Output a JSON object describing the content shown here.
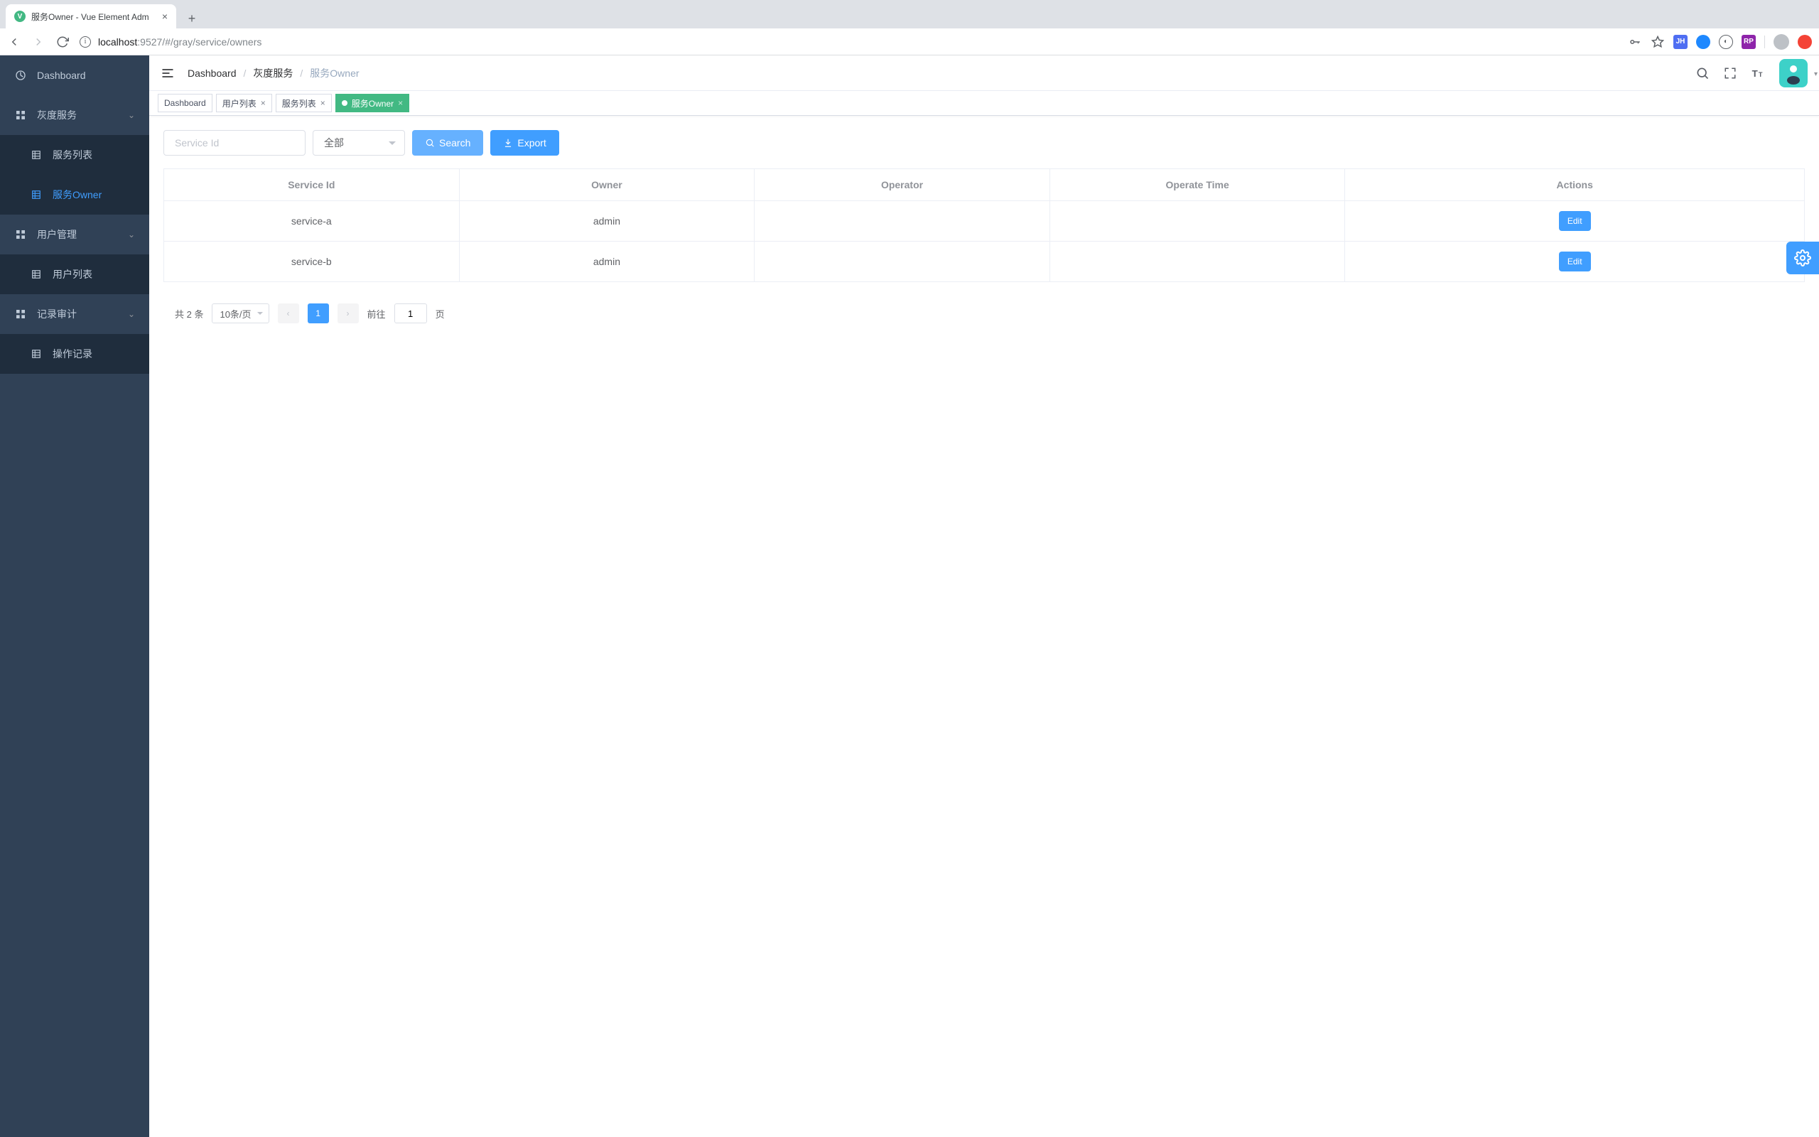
{
  "browser": {
    "tab_title": "服务Owner - Vue Element Adm",
    "url_host": "localhost",
    "url_port_path": ":9527/#/gray/service/owners"
  },
  "sidebar": {
    "items": [
      {
        "label": "Dashboard",
        "type": "item"
      },
      {
        "label": "灰度服务",
        "type": "submenu",
        "children": [
          {
            "label": "服务列表"
          },
          {
            "label": "服务Owner",
            "active": true
          }
        ]
      },
      {
        "label": "用户管理",
        "type": "submenu",
        "children": [
          {
            "label": "用户列表"
          }
        ]
      },
      {
        "label": "记录审计",
        "type": "submenu",
        "children": [
          {
            "label": "操作记录"
          }
        ]
      }
    ]
  },
  "breadcrumb": [
    "Dashboard",
    "灰度服务",
    "服务Owner"
  ],
  "tags": [
    {
      "label": "Dashboard",
      "closable": false
    },
    {
      "label": "用户列表",
      "closable": true
    },
    {
      "label": "服务列表",
      "closable": true
    },
    {
      "label": "服务Owner",
      "closable": true,
      "active": true
    }
  ],
  "filter": {
    "service_id_placeholder": "Service Id",
    "select_value": "全部",
    "search_label": "Search",
    "export_label": "Export"
  },
  "table": {
    "headers": [
      "Service Id",
      "Owner",
      "Operator",
      "Operate Time",
      "Actions"
    ],
    "rows": [
      {
        "service_id": "service-a",
        "owner": "admin",
        "operator": "",
        "operate_time": "",
        "edit_label": "Edit"
      },
      {
        "service_id": "service-b",
        "owner": "admin",
        "operator": "",
        "operate_time": "",
        "edit_label": "Edit"
      }
    ]
  },
  "pagination": {
    "total_text": "共 2 条",
    "page_size": "10条/页",
    "current_page": "1",
    "goto_prefix": "前往",
    "goto_value": "1",
    "goto_suffix": "页"
  }
}
